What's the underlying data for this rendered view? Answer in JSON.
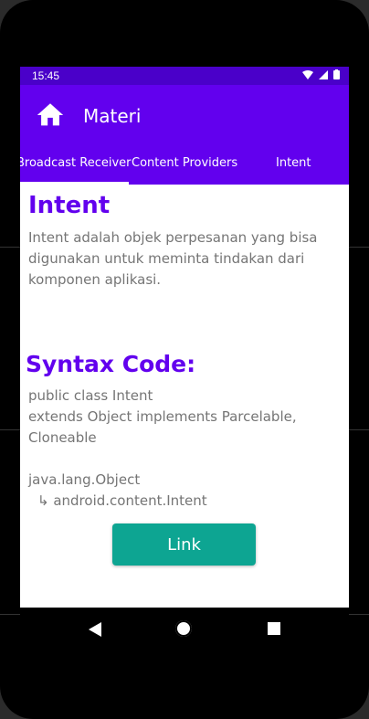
{
  "status_bar": {
    "time": "15:45"
  },
  "app_bar": {
    "title": "Materi"
  },
  "tabs": [
    {
      "label": "Broadcast Receiver"
    },
    {
      "label": "Content Providers"
    },
    {
      "label": "Intent"
    }
  ],
  "content": {
    "heading": "Intent",
    "description": "Intent adalah objek perpesanan yang bisa digunakan untuk meminta tindakan dari komponen aplikasi.",
    "syntax_heading": "Syntax Code:",
    "code": "public class Intent\nextends Object implements Parcelable,\nCloneable",
    "hierarchy": {
      "parent": "java.lang.Object",
      "child": "↳ android.content.Intent"
    },
    "link_label": "Link"
  },
  "colors": {
    "primary": "#6200ee",
    "status": "#4a00c9",
    "accent_button": "#0da592",
    "text_muted": "#757575"
  },
  "icons": {
    "home": "home-icon",
    "back": "back-icon",
    "home_nav": "home-nav-icon",
    "recent": "recent-apps-icon"
  }
}
